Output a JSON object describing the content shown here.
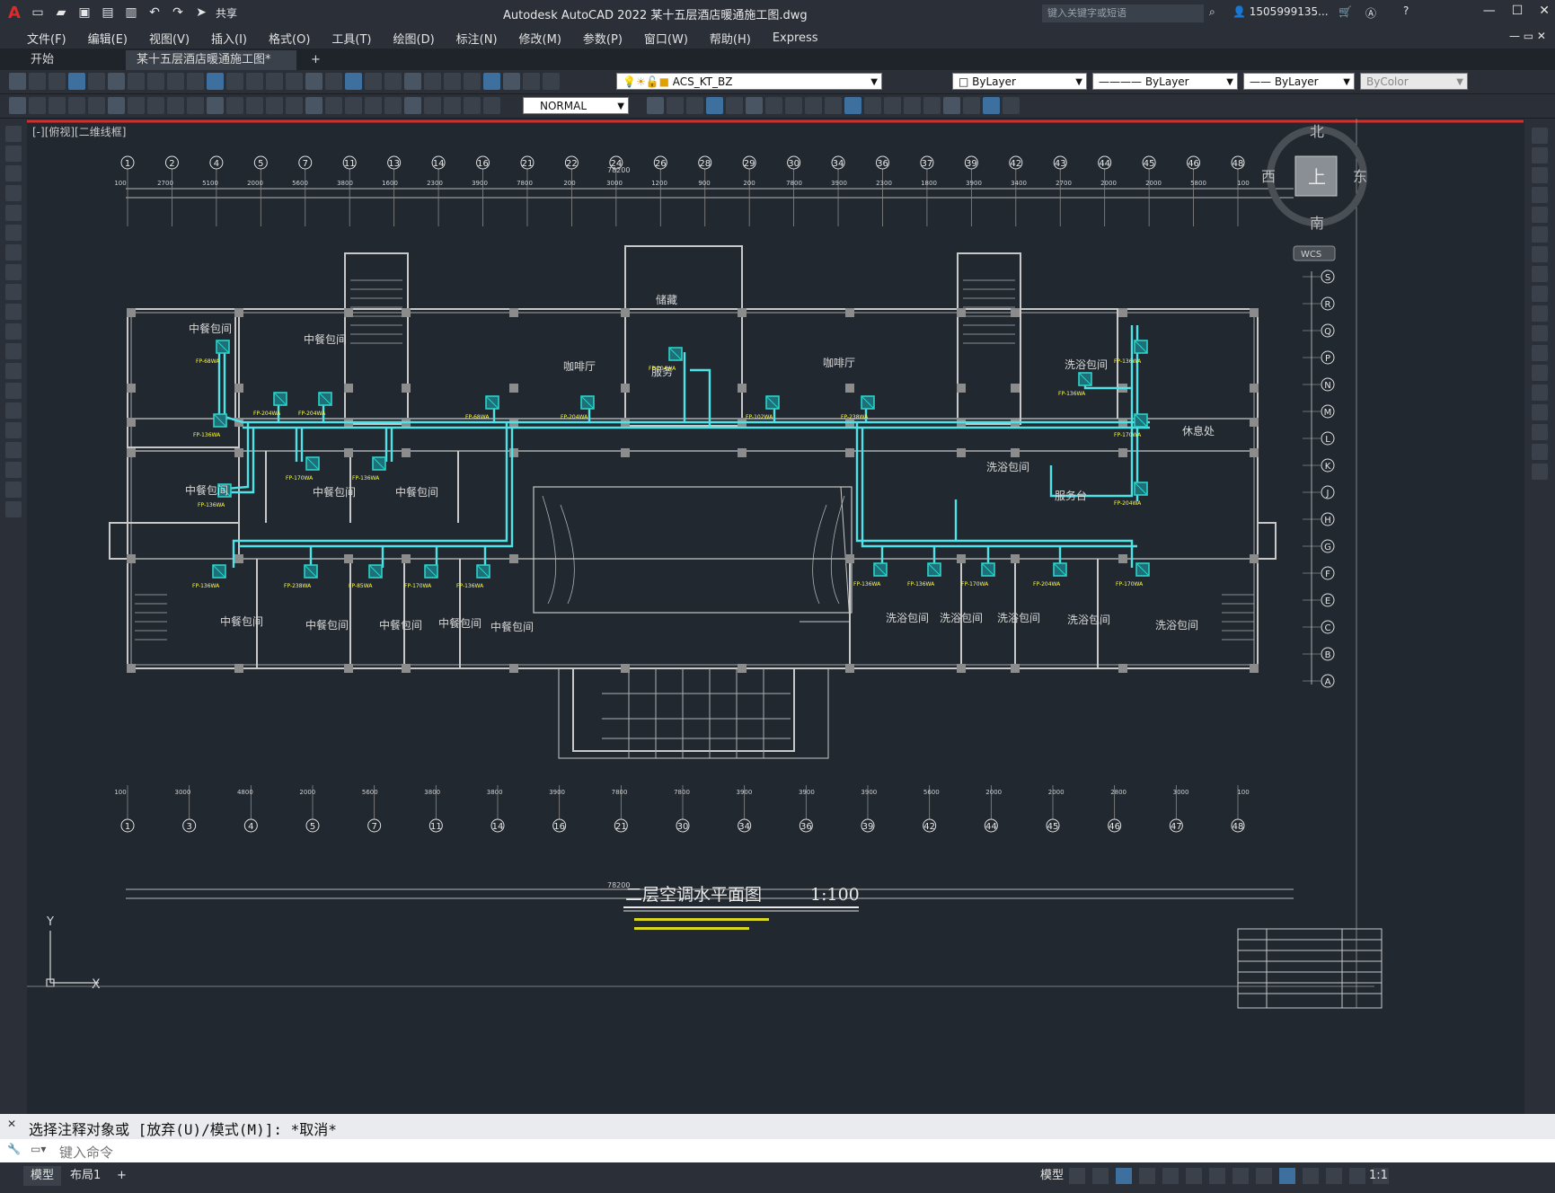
{
  "app": {
    "title": "Autodesk AutoCAD 2022    某十五层酒店暖通施工图.dwg",
    "share_label": "共享",
    "search_placeholder": "键入关键字或短语",
    "user": "1505999135..."
  },
  "menu": [
    "文件(F)",
    "编辑(E)",
    "视图(V)",
    "插入(I)",
    "格式(O)",
    "工具(T)",
    "绘图(D)",
    "标注(N)",
    "修改(M)",
    "参数(P)",
    "窗口(W)",
    "帮助(H)",
    "Express"
  ],
  "tabs": {
    "start": "开始",
    "doc": "某十五层酒店暖通施工图*",
    "close": "×",
    "add": "+"
  },
  "toolbar": {
    "layer": "ACS_KT_BZ",
    "color": "ByLayer",
    "linetype": "ByLayer",
    "lineweight": "ByLayer",
    "plotstyle": "ByColor",
    "textstyle": "NORMAL"
  },
  "viewport": {
    "label": "[-][俯视][二维线框]"
  },
  "viewcube": {
    "top": "上",
    "north": "北",
    "south": "南",
    "east": "东",
    "west": "西",
    "wcs": "WCS"
  },
  "drawing": {
    "title": "二层空调水平面图",
    "scale": "1:100",
    "total_dim": "78200",
    "top_axes": [
      "1",
      "2",
      "4",
      "5",
      "7",
      "11",
      "13",
      "14",
      "16",
      "21",
      "22",
      "24",
      "26",
      "28",
      "29",
      "30",
      "34",
      "36",
      "37",
      "39",
      "42",
      "43",
      "44",
      "45",
      "46",
      "48"
    ],
    "bottom_axes": [
      "1",
      "3",
      "4",
      "5",
      "7",
      "11",
      "14",
      "16",
      "21",
      "30",
      "34",
      "36",
      "39",
      "42",
      "44",
      "45",
      "46",
      "47",
      "48"
    ],
    "row_axes": [
      "S",
      "R",
      "Q",
      "P",
      "N",
      "M",
      "L",
      "K",
      "J",
      "H",
      "G",
      "F",
      "E",
      "C",
      "B",
      "A"
    ],
    "top_dims": [
      "100",
      "2700",
      "5100",
      "2000",
      "5600",
      "3800",
      "1600",
      "2300",
      "3900",
      "7800",
      "200",
      "3000",
      "1200",
      "900",
      "200",
      "7800",
      "3900",
      "2300",
      "1800",
      "3900",
      "3400",
      "2700",
      "2000",
      "2000",
      "5800",
      "100"
    ],
    "bottom_dims": [
      "100",
      "3000",
      "4800",
      "2000",
      "5600",
      "3800",
      "3800",
      "3900",
      "7800",
      "7800",
      "3900",
      "3900",
      "3900",
      "5600",
      "2000",
      "2000",
      "2800",
      "3000",
      "100"
    ],
    "rooms": [
      {
        "name": "中餐包间"
      },
      {
        "name": "中餐包间"
      },
      {
        "name": "中餐包间"
      },
      {
        "name": "中餐包间"
      },
      {
        "name": "中餐包间"
      },
      {
        "name": "中餐包间"
      },
      {
        "name": "中餐包间"
      },
      {
        "name": "中餐包间"
      },
      {
        "name": "中餐包间"
      },
      {
        "name": "中餐包间"
      },
      {
        "name": "储藏"
      },
      {
        "name": "服务"
      },
      {
        "name": "咖啡厅"
      },
      {
        "name": "咖啡厅"
      },
      {
        "name": "洗浴包间"
      },
      {
        "name": "洗浴包间"
      },
      {
        "name": "服务台"
      },
      {
        "name": "休息处"
      },
      {
        "name": "洗浴包间"
      },
      {
        "name": "洗浴包间"
      },
      {
        "name": "洗浴包间"
      },
      {
        "name": "洗浴包间"
      },
      {
        "name": "洗浴包间"
      }
    ],
    "fan_coils": [
      "FP-68WA",
      "FP-136WA",
      "FP-136WA",
      "FP-204WA",
      "FP-204WA",
      "FP-68WA",
      "FP-204WA",
      "FP-204WA",
      "FP-102WA",
      "FP-238WA",
      "FP-136WA",
      "FP-136WA",
      "FP-170WA",
      "FP-204WA",
      "FP-170WA",
      "FP-136WA",
      "FP-136WA",
      "FP-238WA",
      "FP-85WA",
      "FP-170WA",
      "FP-136WA",
      "FP-136WA",
      "FP-136WA",
      "FP-170WA",
      "FP-204WA",
      "FP-170WA"
    ]
  },
  "command": {
    "history": "选择注释对象或 [放弃(U)/模式(M)]: *取消*",
    "placeholder": "键入命令"
  },
  "status": {
    "model_tab": "模型",
    "layout_tab": "布局1",
    "add": "+",
    "model_btn": "模型",
    "scale": "1:1"
  },
  "colors": {
    "accent": "#e02a2a",
    "pipe": "#4fe3e8",
    "fancoil": "#2cd3c8",
    "label": "#ffff33",
    "wall": "#c8c8c8",
    "bg": "#212830"
  }
}
